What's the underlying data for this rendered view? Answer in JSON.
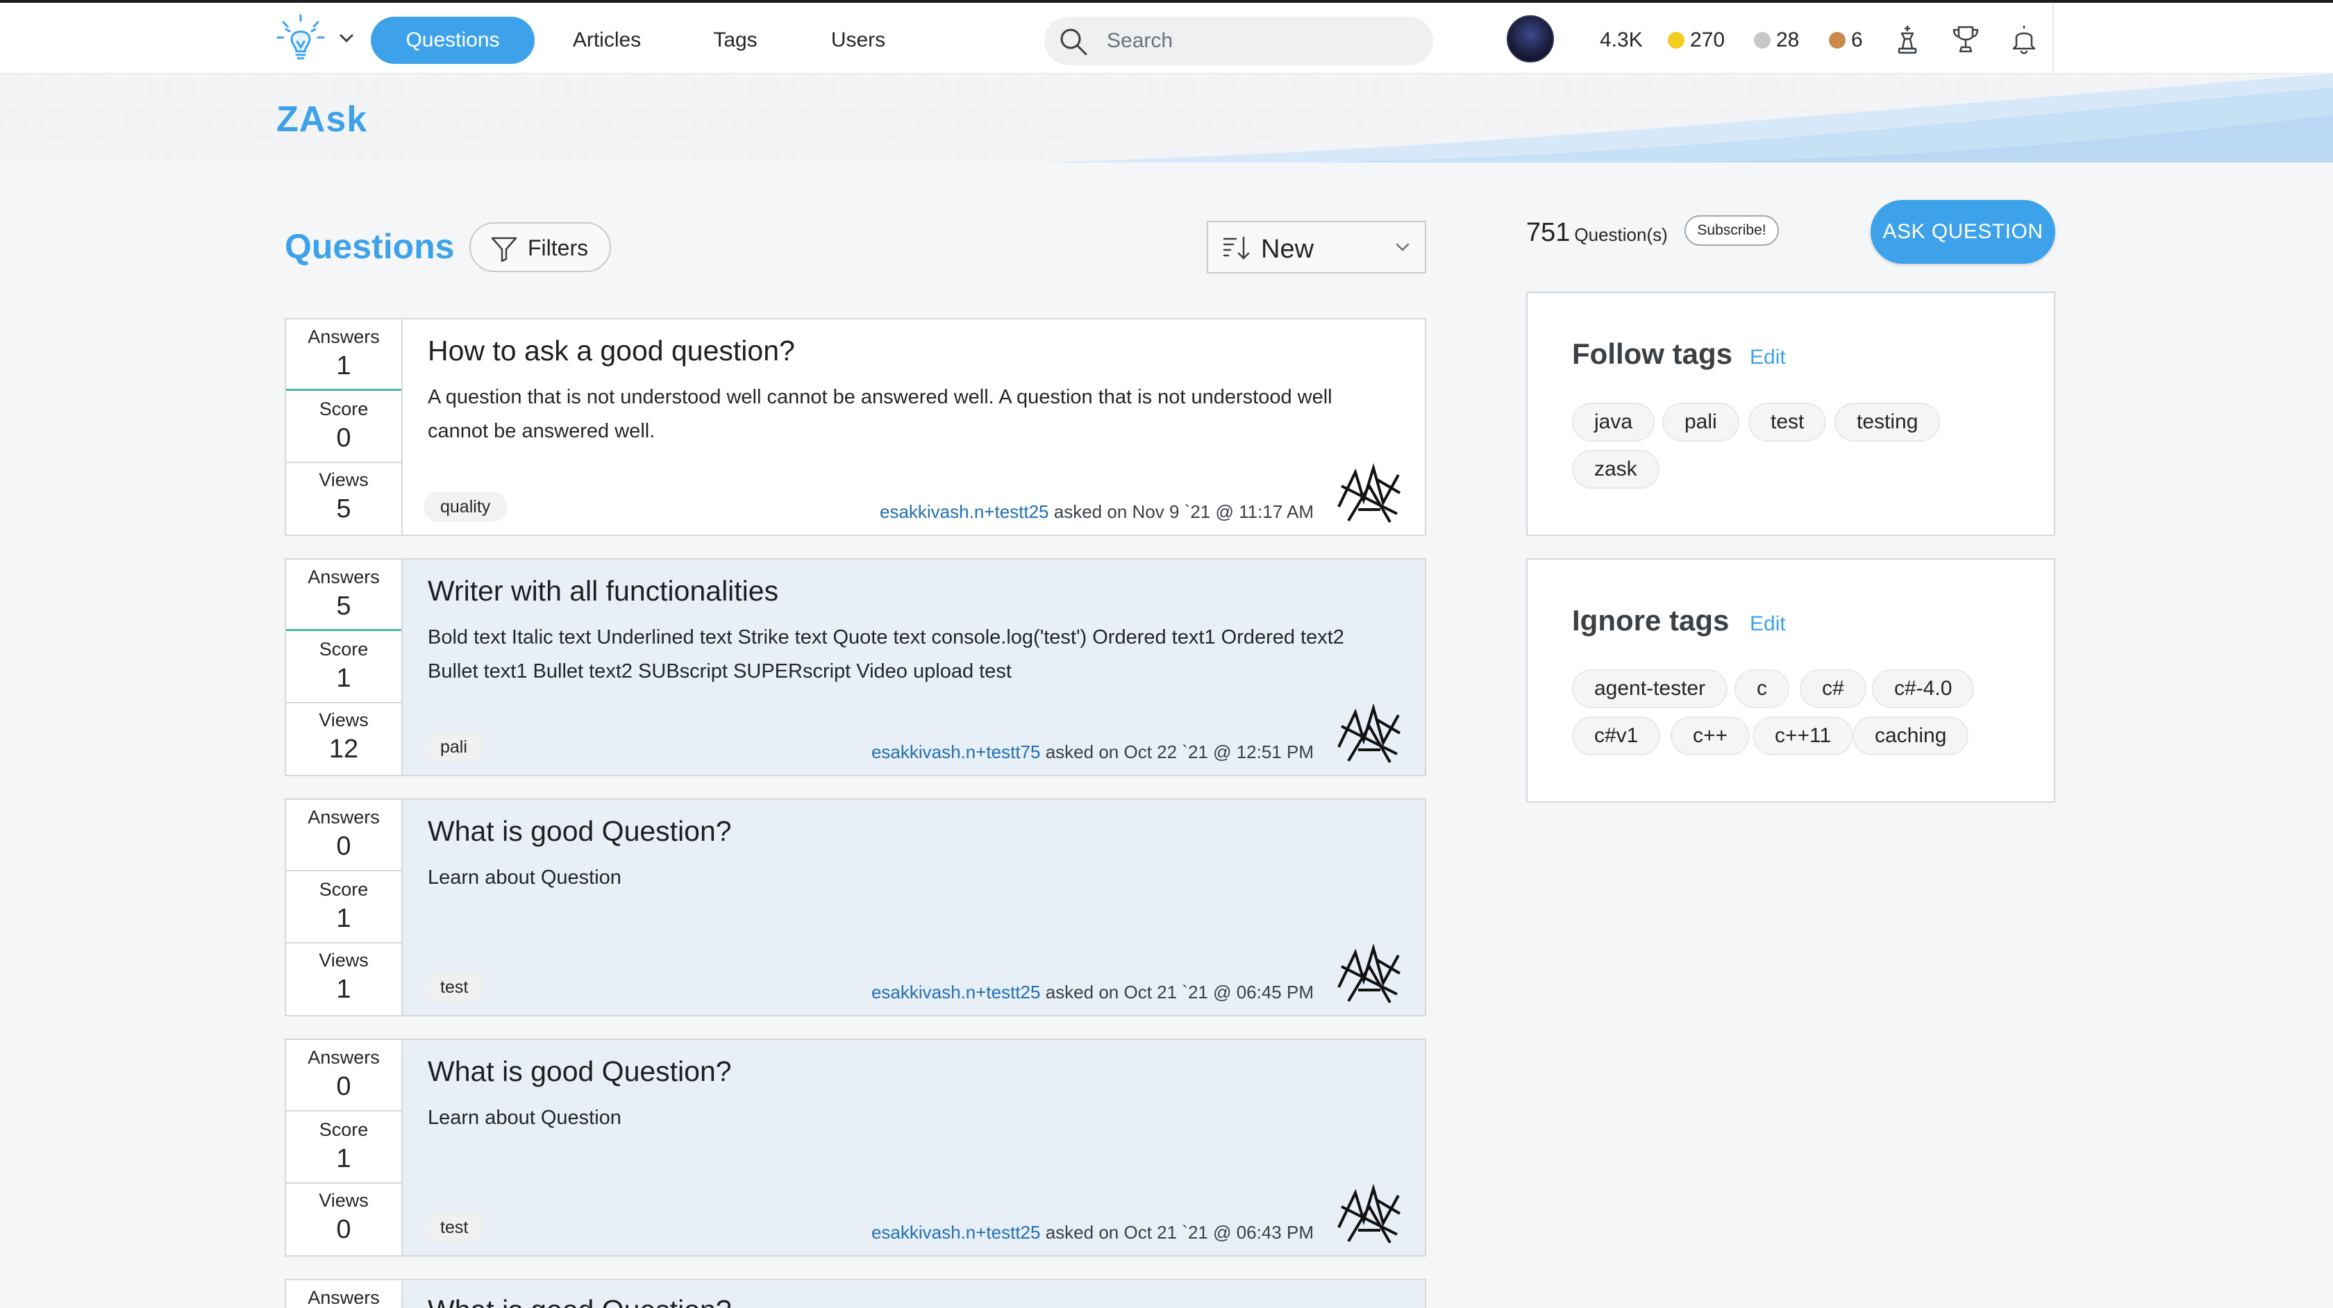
{
  "nav": {
    "tabs": [
      {
        "label": "Questions",
        "active": true
      },
      {
        "label": "Articles",
        "active": false
      },
      {
        "label": "Tags",
        "active": false
      },
      {
        "label": "Users",
        "active": false
      }
    ],
    "search_placeholder": "Search",
    "reputation": "4.3K",
    "gold_badges": "270",
    "silver_badges": "28",
    "bronze_badges": "6",
    "accent_color": "#3ea2ea"
  },
  "banner": {
    "site_name": "ZAsk"
  },
  "main": {
    "heading": "Questions",
    "filters_label": "Filters",
    "sort_label": "New",
    "questions": [
      {
        "answers_label": "Answers",
        "answers": "1",
        "score_label": "Score",
        "score": "0",
        "views_label": "Views",
        "views": "5",
        "title": "How to ask a good question?",
        "excerpt": "A question that is not understood well cannot be answered well. A question that is not understood well cannot be answered well.",
        "tag": "quality",
        "author": "esakkivash.n+testt25",
        "asked": "asked on Nov 9 `21 @ 11:17 AM"
      },
      {
        "answers_label": "Answers",
        "answers": "5",
        "score_label": "Score",
        "score": "1",
        "views_label": "Views",
        "views": "12",
        "title": "Writer with all functionalities",
        "excerpt": "Bold text Italic text Underlined text Strike text Quote text console.log('test') Ordered text1 Ordered text2 Bullet text1 Bullet text2 SUBscript SUPERscript Video upload test",
        "tag": "pali",
        "author": "esakkivash.n+testt75",
        "asked": "asked on Oct 22 `21 @ 12:51 PM"
      },
      {
        "answers_label": "Answers",
        "answers": "0",
        "score_label": "Score",
        "score": "1",
        "views_label": "Views",
        "views": "1",
        "title": "What is good Question?",
        "excerpt": "Learn about Question",
        "tag": "test",
        "author": "esakkivash.n+testt25",
        "asked": "asked on Oct 21 `21 @ 06:45 PM"
      },
      {
        "answers_label": "Answers",
        "answers": "0",
        "score_label": "Score",
        "score": "1",
        "views_label": "Views",
        "views": "0",
        "title": "What is good Question?",
        "excerpt": "Learn about Question",
        "tag": "test",
        "author": "esakkivash.n+testt25",
        "asked": "asked on Oct 21 `21 @ 06:43 PM"
      },
      {
        "answers_label": "Answers",
        "title": "What is good Question?"
      }
    ]
  },
  "sidebar": {
    "question_count": "751",
    "question_count_unit": "Question(s)",
    "subscribe_label": "Subscribe!",
    "ask_label": "ASK QUESTION",
    "follow": {
      "title": "Follow tags",
      "edit_label": "Edit",
      "tags": [
        "java",
        "pali",
        "test",
        "testing",
        "zask"
      ]
    },
    "ignore": {
      "title": "Ignore tags",
      "edit_label": "Edit",
      "tags": [
        "agent-tester",
        "c",
        "c#",
        "c#-4.0",
        "c#v1",
        "c++",
        "c++11",
        "caching"
      ]
    }
  }
}
